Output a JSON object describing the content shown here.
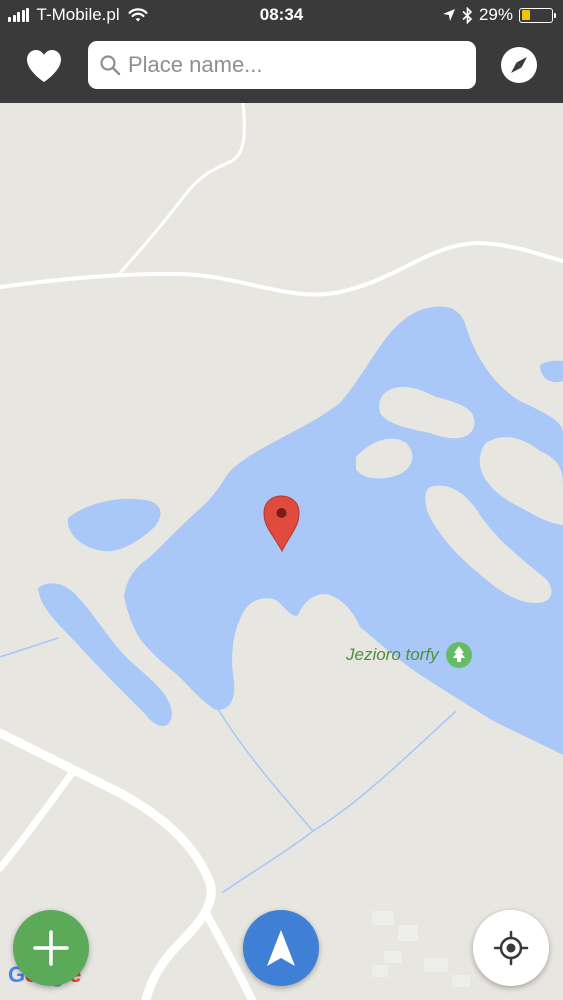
{
  "status_bar": {
    "carrier": "T-Mobile.pl",
    "time": "08:34",
    "battery": "29%",
    "battery_level": 0.29
  },
  "search": {
    "placeholder": "Place name..."
  },
  "map": {
    "place_label": "Jezioro torfy",
    "logo_text": "Google"
  },
  "icons": {
    "favorites": "heart-icon",
    "search": "search-icon",
    "compass": "compass-icon",
    "pin": "map-pin-icon",
    "park": "tree-icon",
    "add": "plus-icon",
    "navigate": "navigation-arrow-icon",
    "locate": "crosshair-icon"
  },
  "colors": {
    "toolbar": "#3a3a3a",
    "land": "#e8e6e1",
    "water": "#a9c8f8",
    "road": "#ffffff",
    "pin": "#e04a3f",
    "add_button": "#5aaa5a",
    "nav_button": "#3f7fd6",
    "park_label": "#4e8f3a"
  }
}
